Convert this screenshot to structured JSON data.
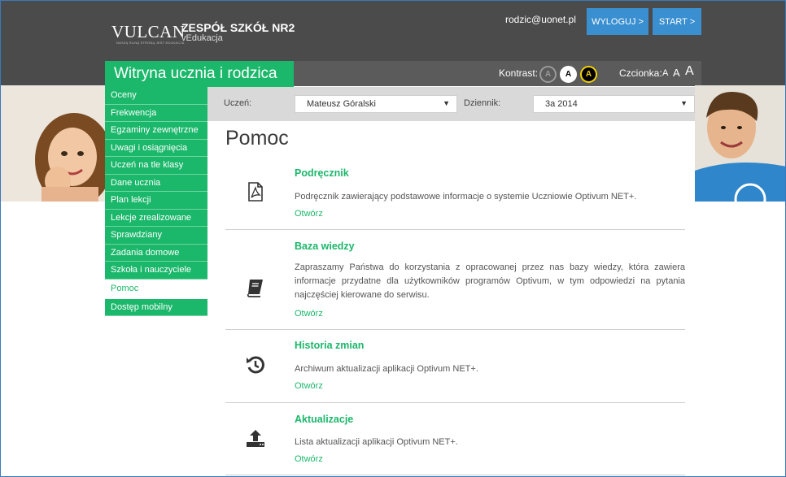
{
  "header": {
    "logo": "VULCAN",
    "logo_tagline": "NASZĄ SILNĄ STRONĄ JEST EDUKACJA",
    "school_name": "ZESPÓŁ SZKÓŁ NR2",
    "school_sub": "vEdukacja",
    "user_email": "rodzic@uonet.pl",
    "logout_label": "WYLOGUJ >",
    "start_label": "START >"
  },
  "title_bar": {
    "title": "Witryna ucznia i rodzica",
    "contrast_label": "Kontrast:",
    "contrast_options": [
      "A",
      "A",
      "A"
    ],
    "font_label": "Czcionka:",
    "font_sizes": [
      "A",
      "A",
      "A"
    ]
  },
  "sidebar": {
    "items": [
      {
        "label": "Oceny"
      },
      {
        "label": "Frekwencja"
      },
      {
        "label": "Egzaminy zewnętrzne"
      },
      {
        "label": "Uwagi i osiągnięcia"
      },
      {
        "label": "Uczeń na tle klasy"
      },
      {
        "label": "Dane ucznia"
      },
      {
        "label": "Plan lekcji"
      },
      {
        "label": "Lekcje zrealizowane"
      },
      {
        "label": "Sprawdziany"
      },
      {
        "label": "Zadania domowe"
      },
      {
        "label": "Szkoła i nauczyciele"
      },
      {
        "label": "Pomoc"
      },
      {
        "label": "Dostęp mobilny"
      }
    ],
    "active_index": 11
  },
  "filters": {
    "student_label": "Uczeń:",
    "student_value": "Mateusz Góralski",
    "journal_label": "Dziennik:",
    "journal_value": "3a 2014"
  },
  "main": {
    "title": "Pomoc",
    "items": [
      {
        "title": "Podręcznik",
        "icon": "pdf-document-icon",
        "desc": "Podręcznik zawierający podstawowe informacje o systemie Uczniowie Optivum NET+.",
        "link": "Otwórz"
      },
      {
        "title": "Baza wiedzy",
        "icon": "book-icon",
        "desc": "Zapraszamy Państwa do korzystania z opracowanej przez nas bazy wiedzy, która zawiera informacje przydatne dla użytkowników programów Optivum, w tym odpowiedzi na pytania najczęściej kierowane do serwisu.",
        "link": "Otwórz"
      },
      {
        "title": "Historia zmian",
        "icon": "history-icon",
        "desc": "Archiwum aktualizacji aplikacji Optivum NET+.",
        "link": "Otwórz"
      },
      {
        "title": "Aktualizacje",
        "icon": "upload-icon",
        "desc": "Lista aktualizacji aplikacji Optivum NET+.",
        "link": "Otwórz"
      }
    ]
  },
  "colors": {
    "green": "#1bb76a",
    "dark_header": "#4b4b4b",
    "blue_button": "#3a8fd0"
  }
}
